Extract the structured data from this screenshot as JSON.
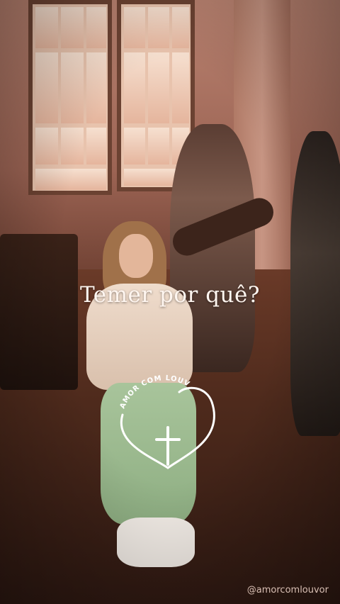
{
  "scene": {
    "caption": "Temer por quê?",
    "handle": "@amorcomlouvor",
    "logo_text": "AMOR COM LOUVOR"
  },
  "colors": {
    "caption": "#fff6f0",
    "logo_stroke": "#ffffff",
    "warm_tone": "#9c6454"
  }
}
